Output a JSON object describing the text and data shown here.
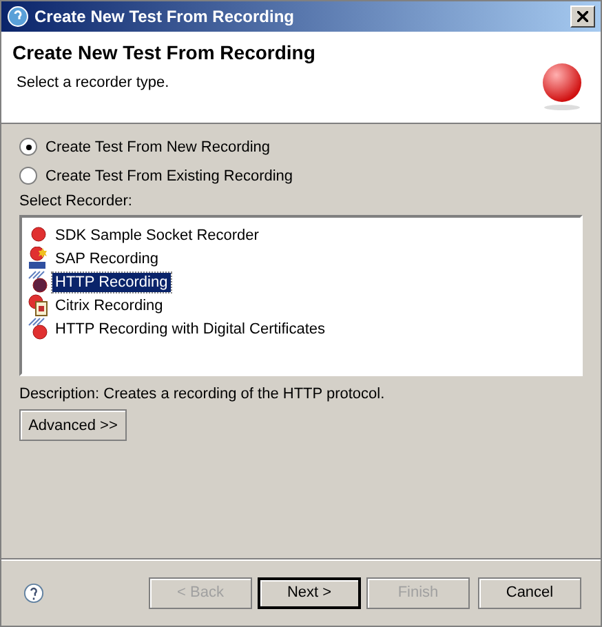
{
  "window": {
    "title": "Create New Test From Recording"
  },
  "header": {
    "title": "Create New Test From Recording",
    "subtitle": "Select a recorder type."
  },
  "options": [
    {
      "label": "Create Test From New Recording",
      "selected": true
    },
    {
      "label": "Create Test From Existing Recording",
      "selected": false
    }
  ],
  "recorder_list": {
    "label": "Select Recorder:",
    "items": [
      {
        "label": "SDK Sample Socket Recorder",
        "kind": "socket",
        "selected": false
      },
      {
        "label": "SAP Recording",
        "kind": "sap",
        "selected": false
      },
      {
        "label": "HTTP Recording",
        "kind": "http",
        "selected": true
      },
      {
        "label": "Citrix Recording",
        "kind": "citrix",
        "selected": false
      },
      {
        "label": "HTTP Recording with Digital Certificates",
        "kind": "cert",
        "selected": false
      }
    ]
  },
  "description": "Description: Creates a recording of the HTTP protocol.",
  "advanced_button": "Advanced >>",
  "buttons": [
    {
      "label": "< Back",
      "disabled": true,
      "default": false
    },
    {
      "label": "Next >",
      "disabled": false,
      "default": true
    },
    {
      "label": "Finish",
      "disabled": true,
      "default": false
    },
    {
      "label": "Cancel",
      "disabled": false,
      "default": false
    }
  ]
}
